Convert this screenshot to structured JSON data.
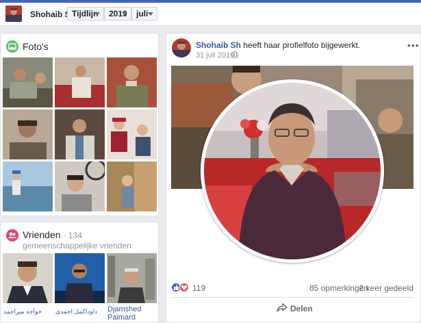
{
  "topbar": {
    "name": "Shohaib Sh",
    "selectors": [
      {
        "id": "section",
        "value": "Tijdlijn"
      },
      {
        "id": "year",
        "value": "2019"
      },
      {
        "id": "month",
        "value": "juli"
      }
    ]
  },
  "photos": {
    "title": "Foto's",
    "icon": "photos-icon",
    "accent": "#5ac26a"
  },
  "friends": {
    "title": "Vrienden",
    "mutual": "· 134 gemeenschappelijke vrienden",
    "icon": "friends-icon",
    "accent": "#e6407b",
    "names": [
      "خواجه میراحمد",
      "داوداکمل احمدی",
      "Djamshed Paimard"
    ]
  },
  "post": {
    "author": "Shohaib Sh",
    "action": "heeft haar profielfoto bijgewerkt.",
    "date": "31 juli 2019",
    "more": "•••",
    "reaction_count": "119",
    "comments": "85 opmerkingen",
    "shares": "2 keer gedeeld",
    "share_label": "Delen"
  },
  "colors": {
    "brand": "#4267b2",
    "link": "#365899",
    "like": "#4267b2",
    "love": "#f25268"
  }
}
